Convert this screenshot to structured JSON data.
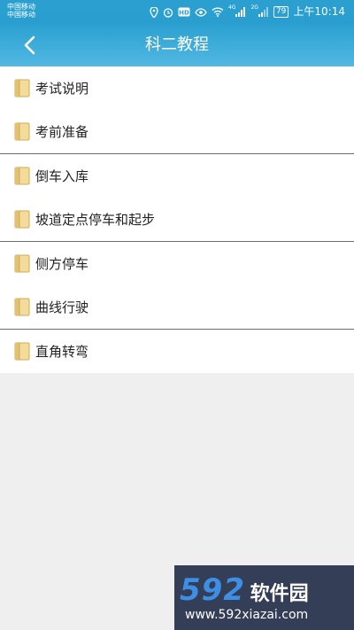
{
  "status_bar": {
    "carrier_line1": "中国移动",
    "carrier_line2": "中国移动",
    "network_4g": "4G",
    "network_2g": "2G",
    "battery": "79",
    "time": "上午10:14"
  },
  "header": {
    "title": "科二教程"
  },
  "list": {
    "items": [
      {
        "label": "考试说明"
      },
      {
        "label": "考前准备"
      },
      {
        "label": "倒车入库"
      },
      {
        "label": "坡道定点停车和起步"
      },
      {
        "label": "侧方停车"
      },
      {
        "label": "曲线行驶"
      },
      {
        "label": "直角转弯"
      }
    ]
  },
  "watermark": {
    "logo_number": "592",
    "logo_text": "软件园",
    "url": "www.592xiazai.com"
  },
  "colors": {
    "header_bg": "#2aa0d0",
    "folder": "#e8c67a"
  }
}
